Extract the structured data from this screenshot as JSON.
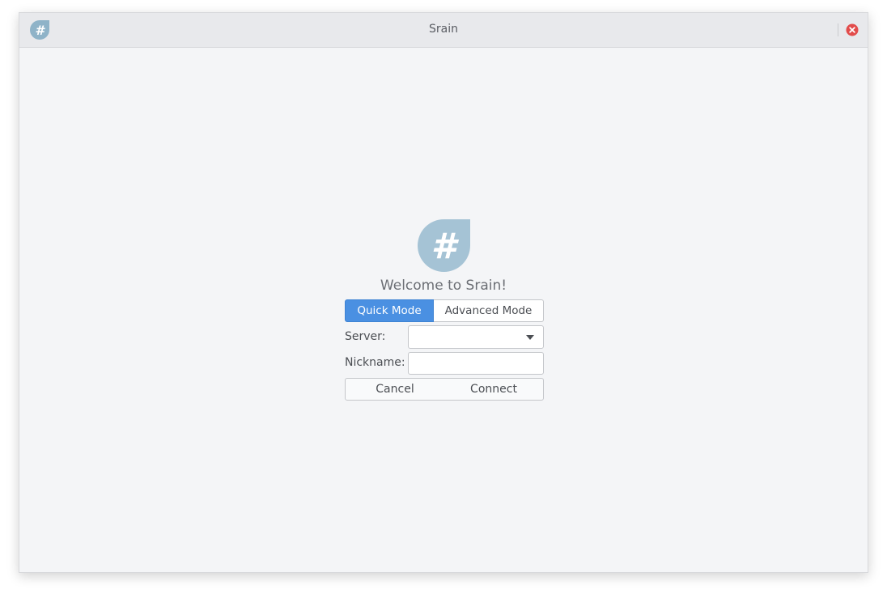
{
  "window": {
    "title": "Srain"
  },
  "dialog": {
    "welcome_text": "Welcome to Srain!",
    "modes": {
      "quick": "Quick Mode",
      "advanced": "Advanced Mode",
      "selected": "Quick Mode"
    },
    "server": {
      "label": "Server:",
      "value": ""
    },
    "nickname": {
      "label": "Nickname:",
      "value": "",
      "placeholder": ""
    },
    "buttons": {
      "cancel": "Cancel",
      "connect": "Connect"
    }
  },
  "icons": {
    "app": "hash-drop-icon",
    "logo": "hash-drop-icon",
    "close": "close-icon",
    "dropdown": "chevron-down-icon"
  },
  "colors": {
    "accent": "#4a90e2",
    "logo": "#a5c3d5",
    "close": "#e24c4b",
    "background": "#f4f5f7"
  }
}
